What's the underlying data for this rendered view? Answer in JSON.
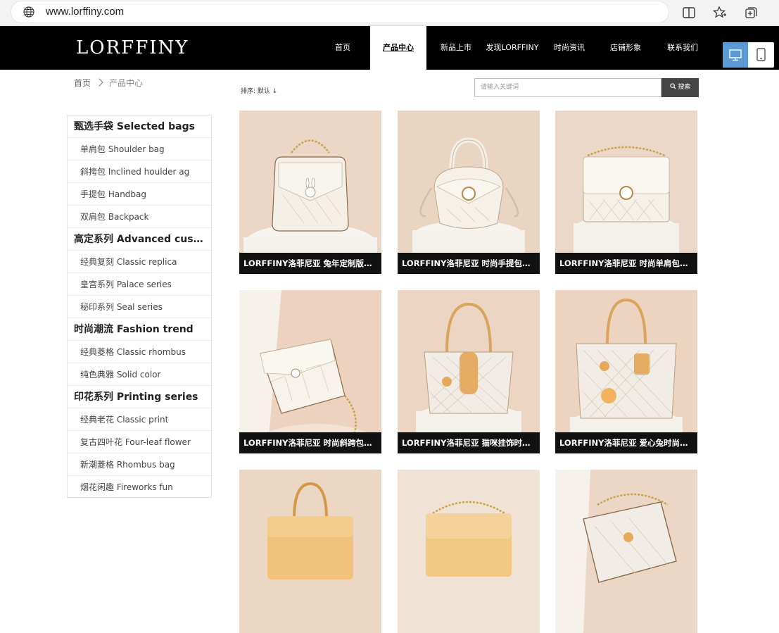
{
  "browser": {
    "url": "www.lorffiny.com",
    "icons": [
      "globe-icon",
      "reader-view-icon",
      "favorites-icon",
      "collections-icon"
    ]
  },
  "header": {
    "logo": "LORFFINY",
    "nav": [
      {
        "label": "首页"
      },
      {
        "label": "产品中心",
        "active": true
      },
      {
        "label": "新品上市"
      },
      {
        "label": "发现LORFFINY"
      },
      {
        "label": "时尚资讯"
      },
      {
        "label": "店铺形象"
      },
      {
        "label": "联系我们"
      }
    ],
    "view_switch": [
      "desktop-icon",
      "tablet-icon"
    ]
  },
  "breadcrumb": [
    "首页",
    "产品中心"
  ],
  "sort": {
    "label": "排序:",
    "value": "默认 ↓"
  },
  "search": {
    "placeholder": "请输入关键词",
    "button": "搜索"
  },
  "sidebar": {
    "groups": [
      {
        "title": "甄选手袋 Selected bags",
        "items": [
          "单肩包 Shoulder bag",
          "斜挎包 Inclined houlder ag",
          "手提包 Handbag",
          "双肩包 Backpack"
        ]
      },
      {
        "title": "高定系列 Advanced customization",
        "items": [
          "经典复刻 Classic replica",
          "皇宫系列 Palace series",
          "秘印系列 Seal series"
        ]
      },
      {
        "title": "时尚潮流 Fashion trend",
        "items": [
          "经典菱格 Classic rhombus",
          "纯色典雅 Solid color"
        ]
      },
      {
        "title": "印花系列 Printing series",
        "items": [
          "经典老花 Classic print",
          "复古四叶花 Four-leaf flower",
          "新潮菱格 Rhombus bag",
          "烟花闲趣 Fireworks fun"
        ]
      }
    ]
  },
  "products": [
    {
      "title": "LORFFINY洛菲尼亚 兔年定制版小方包",
      "bag": "white-quilted-rabbit"
    },
    {
      "title": "LORFFINY洛菲尼亚 时尚手提包单肩包",
      "bag": "white-saddle-handbag"
    },
    {
      "title": "LORFFINY洛菲尼亚 时尚单肩包链条包",
      "bag": "white-square-chain"
    },
    {
      "title": "LORFFINY洛菲尼亚 时尚斜跨包链条包",
      "bag": "white-quilted-cat"
    },
    {
      "title": "LORFFINY洛菲尼亚 猫咪挂饰时尚托特包",
      "bag": "print-tote-cat"
    },
    {
      "title": "LORFFINY洛菲尼亚 爱心兔时尚手提包",
      "bag": "print-tote-rabbit"
    },
    {
      "title": "",
      "bag": "yellow-handbag"
    },
    {
      "title": "",
      "bag": "yellow-chain-bag"
    },
    {
      "title": "",
      "bag": "print-chain-bag"
    }
  ],
  "colors": {
    "header_bg": "#000000",
    "accent": "#5b9bd5",
    "image_bg": "#efd9c8"
  }
}
